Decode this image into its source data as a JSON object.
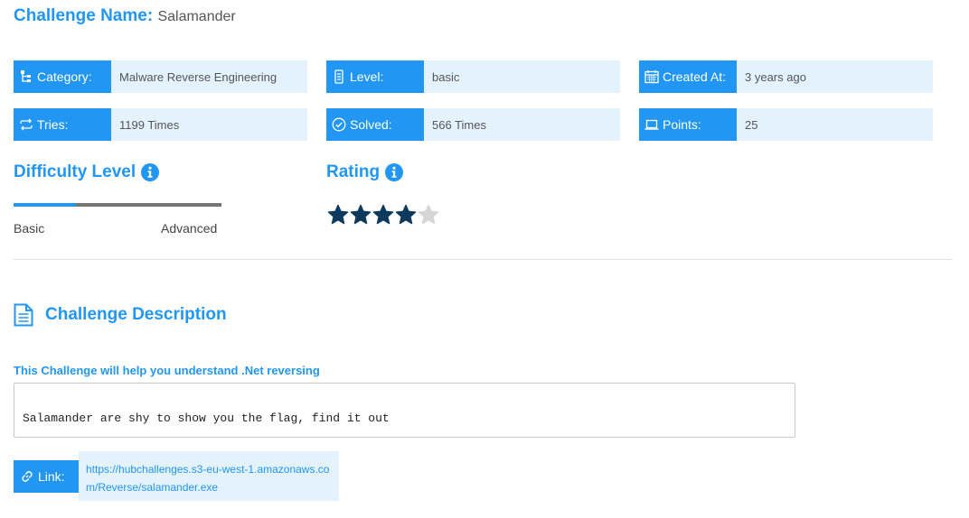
{
  "challenge": {
    "name_label": "Challenge Name:",
    "name_value": "Salamander"
  },
  "stats": {
    "category": {
      "label": "Category:",
      "value": "Malware Reverse Engineering",
      "icon": "sitemap-icon"
    },
    "level": {
      "label": "Level:",
      "value": "basic",
      "icon": "level-bars-icon"
    },
    "created": {
      "label": "Created At:",
      "value": "3 years ago",
      "icon": "calendar-icon"
    },
    "tries": {
      "label": "Tries:",
      "value": "1199 Times",
      "icon": "retry-icon"
    },
    "solved": {
      "label": "Solved:",
      "value": "566 Times",
      "icon": "check-circle-icon"
    },
    "points": {
      "label": "Points:",
      "value": "25",
      "icon": "laptop-icon"
    }
  },
  "difficulty": {
    "title": "Difficulty Level",
    "min_label": "Basic",
    "max_label": "Advanced",
    "level_fraction": 0.3
  },
  "rating": {
    "title": "Rating",
    "value": 4,
    "max": 5
  },
  "description": {
    "heading": "Challenge Description",
    "subtitle": "This Challenge will help you understand .Net reversing",
    "text": "Salamander are shy to show you the flag, find it out"
  },
  "link": {
    "label": "Link:",
    "url": "https://hubchallenges.s3-eu-west-1.amazonaws.com/Reverse/salamander.exe"
  },
  "colors": {
    "accent": "#2196f3",
    "cell_bg": "#e3f2fd",
    "star_filled": "#0d3a5c",
    "star_empty": "#d6d6d6"
  }
}
